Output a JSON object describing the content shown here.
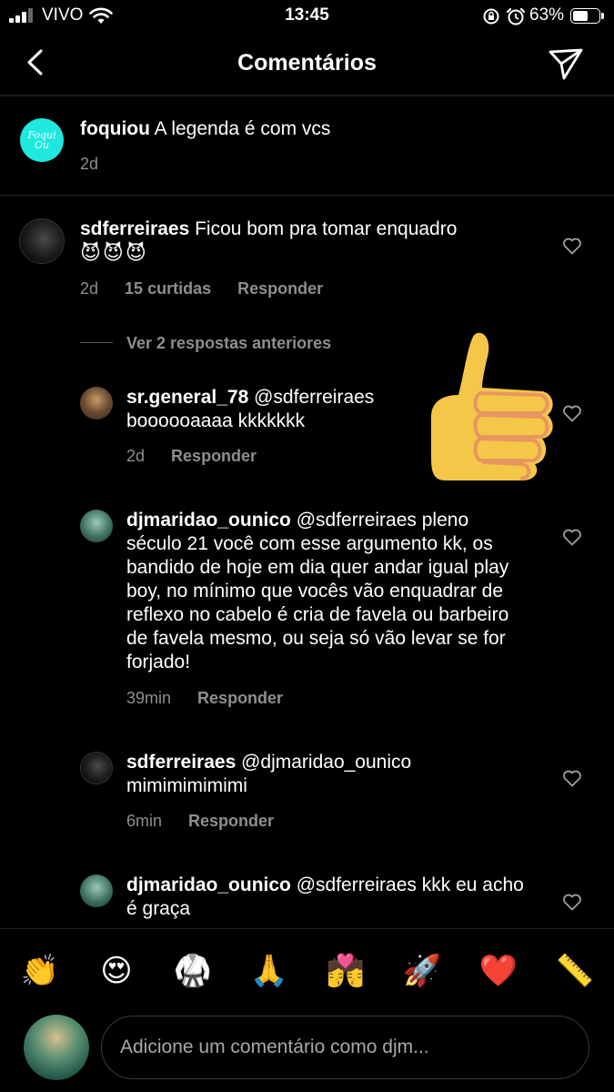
{
  "status_bar": {
    "carrier": "VIVO",
    "time": "13:45",
    "battery": "63%",
    "battery_level": 0.63
  },
  "header": {
    "title": "Comentários"
  },
  "caption": {
    "username": "foquiou",
    "text": "A legenda é com vcs",
    "time": "2d",
    "avatar_text": "Foqui Ou"
  },
  "comment_main": {
    "username": "sdferreiraes",
    "text": "Ficou bom pra tomar enquadro",
    "emojis": "😈😈😈",
    "time": "2d",
    "likes": "15 curtidas",
    "reply": "Responder"
  },
  "view_replies": "Ver 2 respostas anteriores",
  "replies": [
    {
      "username": "sr.general_78",
      "mention": "@sdferreiraes",
      "text": "boooooaaaa kkkkkkk",
      "time": "2d",
      "reply": "Responder"
    },
    {
      "username": "djmaridao_ounico",
      "mention": "@sdferreiraes",
      "text": "pleno século 21 você com esse argumento kk, os bandido de hoje em dia quer andar igual play boy, no mínimo que vocês vão enquadrar de reflexo no cabelo é cria de favela ou barbeiro de favela mesmo, ou seja só vão levar se for forjado!",
      "time": "39min",
      "reply": "Responder"
    },
    {
      "username": "sdferreiraes",
      "mention": "@djmaridao_ounico",
      "text": "mimimimimimi",
      "time": "6min",
      "reply": "Responder"
    },
    {
      "username": "djmaridao_ounico",
      "mention": "@sdferreiraes",
      "text": "kkk eu acho é graça"
    }
  ],
  "emoji_bar": [
    "👏",
    "😍",
    "🥋",
    "🙏",
    "💏",
    "🚀",
    "❤️",
    "📏"
  ],
  "input": {
    "placeholder": "Adicione um comentário como djm..."
  },
  "colors": {
    "background": "#000000",
    "secondary_text": "#8e8e8e",
    "caption_avatar": "#1ee8e0",
    "thumbs_up": "#f5c748"
  },
  "icons": [
    "back-icon",
    "send-icon",
    "heart-icon",
    "thumbs-up-icon"
  ]
}
